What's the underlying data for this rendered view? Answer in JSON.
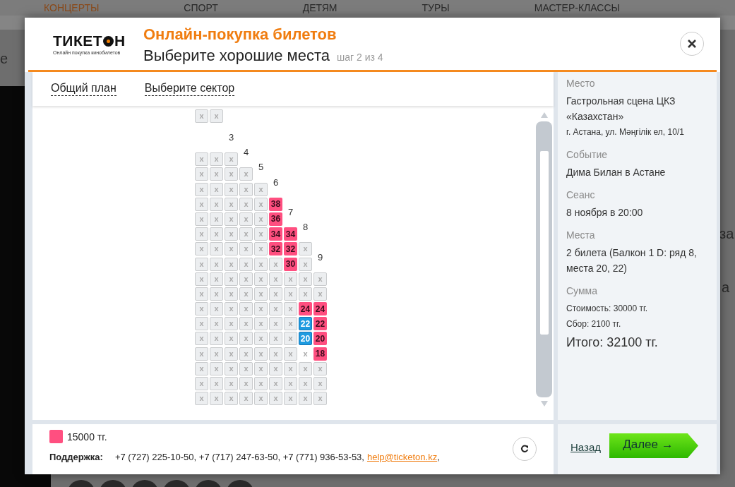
{
  "background_page": {
    "nav": [
      {
        "label": "КОНЦЕРТЫ",
        "selected": true
      },
      {
        "label": "СПОРТ",
        "selected": false
      },
      {
        "label": "ДЕТЯМ",
        "selected": false
      },
      {
        "label": "ТУРЫ",
        "selected": false
      },
      {
        "label": "МАСТЕР-КЛАССЫ",
        "selected": false
      }
    ],
    "fragments": [
      "е",
      "за",
      "а"
    ]
  },
  "dialog": {
    "logo": {
      "name": "ТИКЕТ",
      "name_end": "Н",
      "tagline": "Онлайн покупка кинобилетов"
    },
    "title": "Онлайн-покупка билетов",
    "subtitle": "Выберите хорошие места",
    "step": "шаг 2 из 4"
  },
  "map_tabs": [
    {
      "label": "Общий план"
    },
    {
      "label": "Выберите сектор"
    }
  ],
  "seat_rows": [
    [
      {
        "kind": "taken",
        "label": "x"
      },
      {
        "kind": "taken",
        "label": "x"
      }
    ],
    [
      {
        "kind": "gap"
      },
      {
        "kind": "gap"
      },
      {
        "kind": "row_number",
        "label": "3"
      }
    ],
    [
      {
        "kind": "taken",
        "label": "x"
      },
      {
        "kind": "taken",
        "label": "x"
      },
      {
        "kind": "taken",
        "label": "x"
      },
      {
        "kind": "row_number",
        "label": "4"
      }
    ],
    [
      {
        "kind": "taken",
        "label": "x"
      },
      {
        "kind": "taken",
        "label": "x"
      },
      {
        "kind": "taken",
        "label": "x"
      },
      {
        "kind": "taken",
        "label": "x"
      },
      {
        "kind": "row_number",
        "label": "5"
      }
    ],
    [
      {
        "kind": "taken",
        "label": "x"
      },
      {
        "kind": "taken",
        "label": "x"
      },
      {
        "kind": "taken",
        "label": "x"
      },
      {
        "kind": "taken",
        "label": "x"
      },
      {
        "kind": "taken",
        "label": "x"
      },
      {
        "kind": "row_number",
        "label": "6"
      }
    ],
    [
      {
        "kind": "taken",
        "label": "x"
      },
      {
        "kind": "taken",
        "label": "x"
      },
      {
        "kind": "taken",
        "label": "x"
      },
      {
        "kind": "taken",
        "label": "x"
      },
      {
        "kind": "taken",
        "label": "x"
      },
      {
        "kind": "open",
        "label": "38",
        "selected": false
      }
    ],
    [
      {
        "kind": "taken",
        "label": "x"
      },
      {
        "kind": "taken",
        "label": "x"
      },
      {
        "kind": "taken",
        "label": "x"
      },
      {
        "kind": "taken",
        "label": "x"
      },
      {
        "kind": "taken",
        "label": "x"
      },
      {
        "kind": "open",
        "label": "36",
        "selected": false
      },
      {
        "kind": "row_number",
        "label": "7"
      }
    ],
    [
      {
        "kind": "taken",
        "label": "x"
      },
      {
        "kind": "taken",
        "label": "x"
      },
      {
        "kind": "taken",
        "label": "x"
      },
      {
        "kind": "taken",
        "label": "x"
      },
      {
        "kind": "taken",
        "label": "x"
      },
      {
        "kind": "open",
        "label": "34",
        "selected": false
      },
      {
        "kind": "open",
        "label": "34",
        "selected": false
      },
      {
        "kind": "row_number",
        "label": "8"
      }
    ],
    [
      {
        "kind": "taken",
        "label": "x"
      },
      {
        "kind": "taken",
        "label": "x"
      },
      {
        "kind": "taken",
        "label": "x"
      },
      {
        "kind": "taken",
        "label": "x"
      },
      {
        "kind": "taken",
        "label": "x"
      },
      {
        "kind": "open",
        "label": "32",
        "selected": false
      },
      {
        "kind": "open",
        "label": "32",
        "selected": false
      },
      {
        "kind": "taken",
        "label": "x"
      }
    ],
    [
      {
        "kind": "taken",
        "label": "x"
      },
      {
        "kind": "taken",
        "label": "x"
      },
      {
        "kind": "taken",
        "label": "x"
      },
      {
        "kind": "taken",
        "label": "x"
      },
      {
        "kind": "taken",
        "label": "x"
      },
      {
        "kind": "taken",
        "label": "x"
      },
      {
        "kind": "open",
        "label": "30",
        "selected": false
      },
      {
        "kind": "taken",
        "label": "x"
      },
      {
        "kind": "row_number",
        "label": "9"
      }
    ],
    [
      {
        "kind": "taken",
        "label": "x"
      },
      {
        "kind": "taken",
        "label": "x"
      },
      {
        "kind": "taken",
        "label": "x"
      },
      {
        "kind": "taken",
        "label": "x"
      },
      {
        "kind": "taken",
        "label": "x"
      },
      {
        "kind": "taken",
        "label": "x"
      },
      {
        "kind": "taken",
        "label": "x"
      },
      {
        "kind": "taken",
        "label": "x"
      },
      {
        "kind": "taken",
        "label": "x"
      }
    ],
    [
      {
        "kind": "taken",
        "label": "x"
      },
      {
        "kind": "taken",
        "label": "x"
      },
      {
        "kind": "taken",
        "label": "x"
      },
      {
        "kind": "taken",
        "label": "x"
      },
      {
        "kind": "taken",
        "label": "x"
      },
      {
        "kind": "taken",
        "label": "x"
      },
      {
        "kind": "taken",
        "label": "x"
      },
      {
        "kind": "taken",
        "label": "x"
      },
      {
        "kind": "taken",
        "label": "x"
      }
    ],
    [
      {
        "kind": "taken",
        "label": "x"
      },
      {
        "kind": "taken",
        "label": "x"
      },
      {
        "kind": "taken",
        "label": "x"
      },
      {
        "kind": "taken",
        "label": "x"
      },
      {
        "kind": "taken",
        "label": "x"
      },
      {
        "kind": "taken",
        "label": "x"
      },
      {
        "kind": "taken",
        "label": "x"
      },
      {
        "kind": "open",
        "label": "24",
        "selected": false
      },
      {
        "kind": "open",
        "label": "24",
        "selected": false
      }
    ],
    [
      {
        "kind": "taken",
        "label": "x"
      },
      {
        "kind": "taken",
        "label": "x"
      },
      {
        "kind": "taken",
        "label": "x"
      },
      {
        "kind": "taken",
        "label": "x"
      },
      {
        "kind": "taken",
        "label": "x"
      },
      {
        "kind": "taken",
        "label": "x"
      },
      {
        "kind": "taken",
        "label": "x"
      },
      {
        "kind": "open",
        "label": "22",
        "selected": true
      },
      {
        "kind": "open",
        "label": "22",
        "selected": false
      }
    ],
    [
      {
        "kind": "taken",
        "label": "x"
      },
      {
        "kind": "taken",
        "label": "x"
      },
      {
        "kind": "taken",
        "label": "x"
      },
      {
        "kind": "taken",
        "label": "x"
      },
      {
        "kind": "taken",
        "label": "x"
      },
      {
        "kind": "taken",
        "label": "x"
      },
      {
        "kind": "taken",
        "label": "x"
      },
      {
        "kind": "open",
        "label": "20",
        "selected": true
      },
      {
        "kind": "open",
        "label": "20",
        "selected": false
      }
    ],
    [
      {
        "kind": "taken",
        "label": "x"
      },
      {
        "kind": "taken",
        "label": "x"
      },
      {
        "kind": "taken",
        "label": "x"
      },
      {
        "kind": "taken",
        "label": "x"
      },
      {
        "kind": "taken",
        "label": "x"
      },
      {
        "kind": "taken",
        "label": "x"
      },
      {
        "kind": "taken",
        "label": "x"
      },
      {
        "kind": "blocked",
        "label": "x"
      },
      {
        "kind": "open",
        "label": "18",
        "selected": false
      }
    ],
    [
      {
        "kind": "taken",
        "label": "x"
      },
      {
        "kind": "taken",
        "label": "x"
      },
      {
        "kind": "taken",
        "label": "x"
      },
      {
        "kind": "taken",
        "label": "x"
      },
      {
        "kind": "taken",
        "label": "x"
      },
      {
        "kind": "taken",
        "label": "x"
      },
      {
        "kind": "taken",
        "label": "x"
      },
      {
        "kind": "taken",
        "label": "x"
      },
      {
        "kind": "taken",
        "label": "x"
      }
    ],
    [
      {
        "kind": "taken",
        "label": "x"
      },
      {
        "kind": "taken",
        "label": "x"
      },
      {
        "kind": "taken",
        "label": "x"
      },
      {
        "kind": "taken",
        "label": "x"
      },
      {
        "kind": "taken",
        "label": "x"
      },
      {
        "kind": "taken",
        "label": "x"
      },
      {
        "kind": "taken",
        "label": "x"
      },
      {
        "kind": "taken",
        "label": "x"
      },
      {
        "kind": "taken",
        "label": "x"
      }
    ],
    [
      {
        "kind": "taken",
        "label": "x"
      },
      {
        "kind": "taken",
        "label": "x"
      },
      {
        "kind": "taken",
        "label": "x"
      },
      {
        "kind": "taken",
        "label": "x"
      },
      {
        "kind": "taken",
        "label": "x"
      },
      {
        "kind": "taken",
        "label": "x"
      },
      {
        "kind": "taken",
        "label": "x"
      },
      {
        "kind": "taken",
        "label": "x"
      },
      {
        "kind": "taken",
        "label": "x"
      }
    ]
  ],
  "order_info": [
    {
      "label": "Место",
      "lines": [
        {
          "kind": "normal",
          "text": "Гастрольная сцена ЦКЗ «Казахстан»"
        },
        {
          "kind": "small",
          "text": "г. Астана, ул. Мәңгілік ел, 10/1"
        }
      ]
    },
    {
      "label": "Событие",
      "lines": [
        {
          "kind": "normal",
          "text": "Дима Билан в Астане"
        }
      ]
    },
    {
      "label": "Сеанс",
      "lines": [
        {
          "kind": "normal",
          "text": "8 ноября в 20:00"
        }
      ]
    },
    {
      "label": "Места",
      "lines": [
        {
          "kind": "normal",
          "text": "2 билета (Балкон 1 D: ряд 8, места 20, 22)"
        }
      ]
    },
    {
      "label": "Сумма",
      "lines": [
        {
          "kind": "small",
          "text": "Стоимость: 30000 тг."
        },
        {
          "kind": "small",
          "text": "Сбор: 2100 тг."
        },
        {
          "kind": "large",
          "text": "Итого: 32100 тг."
        }
      ]
    }
  ],
  "legend": [
    {
      "color": "#ff4f80",
      "price": "15000 тг."
    }
  ],
  "support": {
    "label": "Поддержка:",
    "phones": "+7 (727) 225-10-50, +7 (717) 247-63-50, +7 (771) 936-53-53,",
    "email": "help@ticketon.kz",
    "tail": ","
  },
  "back_link": "Назад",
  "next_button": "Далее →"
}
